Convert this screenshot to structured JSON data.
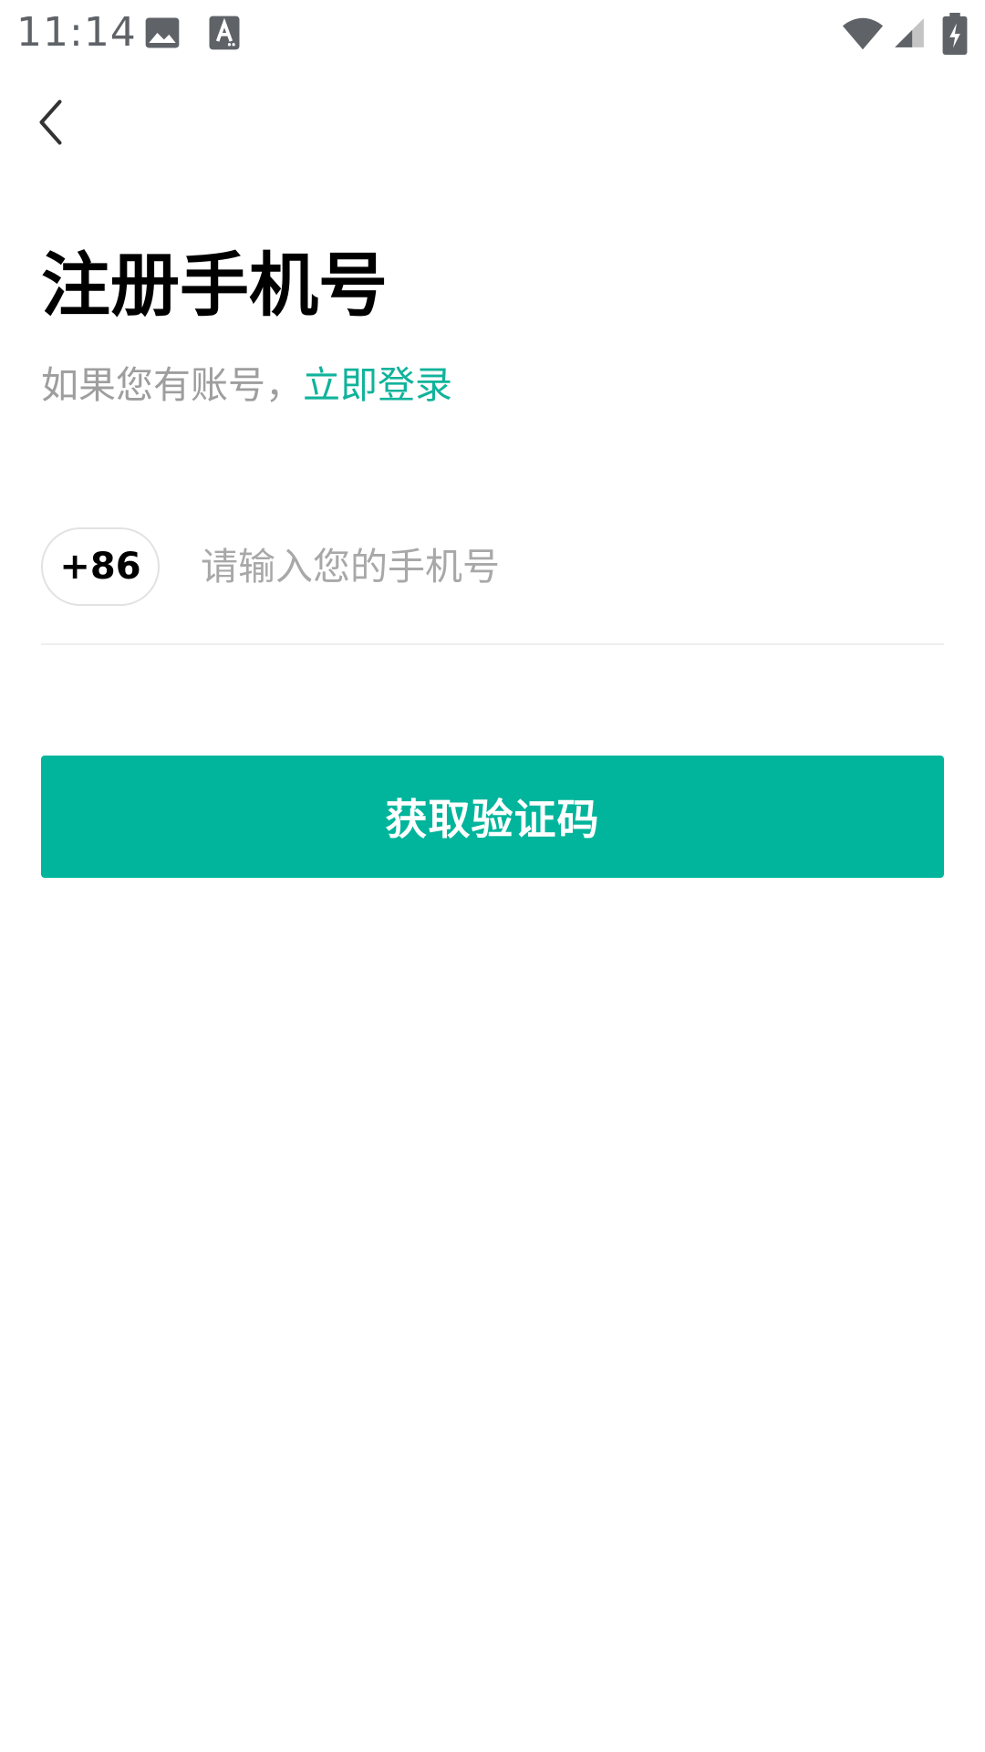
{
  "status_bar": {
    "time": "11:14",
    "icons": [
      "image-icon",
      "text-a-icon",
      "wifi-icon",
      "signal-icon",
      "battery-charging-icon"
    ]
  },
  "header": {
    "back_icon": "chevron-left-icon"
  },
  "main": {
    "title": "注册手机号",
    "subtitle_prefix": "如果您有账号，",
    "login_link": "立即登录",
    "country_code": "+86",
    "phone_placeholder": "请输入您的手机号",
    "phone_value": "",
    "submit_label": "获取验证码"
  },
  "colors": {
    "accent": "#00b59b",
    "link": "#10b39b",
    "muted_text": "#9e9e9e",
    "title_text": "#000000"
  }
}
